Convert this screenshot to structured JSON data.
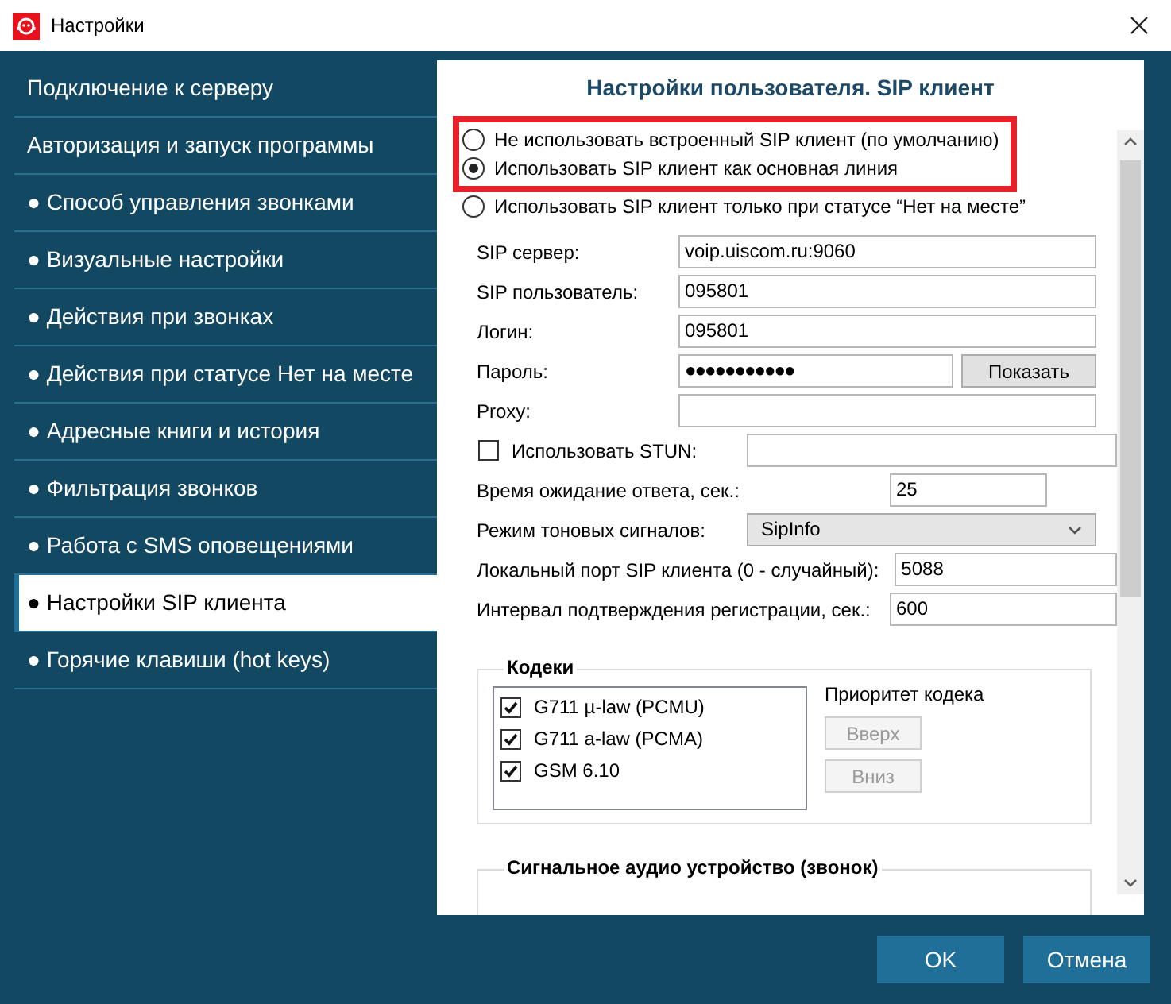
{
  "window": {
    "title": "Настройки"
  },
  "sidebar": {
    "items": [
      {
        "label": "Подключение к серверу",
        "selected": false
      },
      {
        "label": "Авторизация и запуск программы",
        "selected": false
      },
      {
        "label": "● Способ управления звонками",
        "selected": false
      },
      {
        "label": "● Визуальные настройки",
        "selected": false
      },
      {
        "label": "● Действия при звонках",
        "selected": false
      },
      {
        "label": "● Действия при статусе Нет на месте",
        "selected": false
      },
      {
        "label": "● Адресные книги и история",
        "selected": false
      },
      {
        "label": "● Фильтрация звонков",
        "selected": false
      },
      {
        "label": "● Работа с SMS оповещениями",
        "selected": false
      },
      {
        "label": "● Настройки SIP клиента",
        "selected": true
      },
      {
        "label": "● Горячие клавиши (hot keys)",
        "selected": false
      }
    ]
  },
  "panel": {
    "heading": "Настройки пользователя. SIP клиент",
    "radios": [
      {
        "label": "Не использовать встроенный SIP клиент (по умолчанию)",
        "selected": false,
        "highlighted": true
      },
      {
        "label": "Использовать SIP клиент как основная линия",
        "selected": true,
        "highlighted": true
      },
      {
        "label": "Использовать SIP клиент только при статусе “Нет на месте”",
        "selected": false,
        "highlighted": false
      }
    ],
    "fields": [
      {
        "kind": "text",
        "label": "SIP сервер:",
        "value": "voip.uiscom.ru:9060"
      },
      {
        "kind": "text",
        "label": "SIP пользователь:",
        "value": "095801"
      },
      {
        "kind": "text",
        "label": "Логин:",
        "value": "095801"
      },
      {
        "kind": "password",
        "label": "Пароль:",
        "value": "●●●●●●●●●●●",
        "button": "Показать"
      },
      {
        "kind": "text",
        "label": "Proxy:"
      },
      {
        "kind": "checkbox",
        "label": "Использовать STUN:",
        "checked": false
      },
      {
        "kind": "number",
        "label": "Время ожидание ответа, сек.:",
        "value": "25"
      },
      {
        "kind": "select",
        "label": "Режим тоновых сигналов:",
        "value": "SipInfo"
      },
      {
        "kind": "text",
        "label": "Локальный порт SIP клиента (0 - случайный):",
        "value": "5088"
      },
      {
        "kind": "text",
        "label": "Интервал подтверждения регистрации, сек.:",
        "value": "600"
      }
    ],
    "codecs": {
      "title": "Кодеки",
      "items": [
        {
          "label": "G711 µ-law (PCMU)",
          "checked": true
        },
        {
          "label": "G711 a-law (PCMA)",
          "checked": true
        },
        {
          "label": "GSM 6.10",
          "checked": true
        }
      ],
      "priority_label": "Приоритет кодека",
      "buttons": [
        {
          "label": "Вверх",
          "disabled": true
        },
        {
          "label": "Вниз",
          "disabled": true
        }
      ]
    },
    "audio_group": {
      "title": "Сигнальное аудио устройство (звонок)"
    }
  },
  "footer": {
    "buttons": [
      "OK",
      "Отмена"
    ]
  }
}
